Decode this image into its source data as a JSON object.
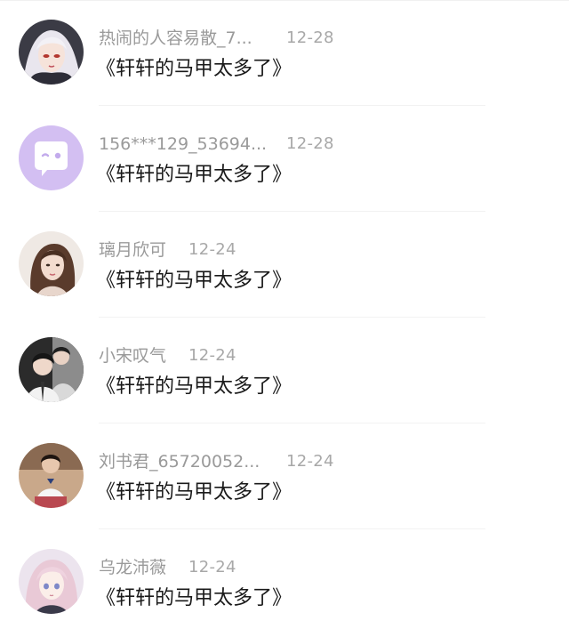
{
  "comments": [
    {
      "username": "热闹的人容易散_7...",
      "date": "12-28",
      "text": "《轩轩的马甲太多了》",
      "avatar": "anime-girl-white-hair-avatar"
    },
    {
      "username": "156***129_53694...",
      "date": "12-28",
      "text": "《轩轩的马甲太多了》",
      "avatar": "default-chat-bubble-avatar"
    },
    {
      "username": "璃月欣可",
      "date": "12-24",
      "text": "《轩轩的马甲太多了》",
      "avatar": "girl-selfie-avatar"
    },
    {
      "username": "小宋叹气",
      "date": "12-24",
      "text": "《轩轩的马甲太多了》",
      "avatar": "two-boys-photo-avatar"
    },
    {
      "username": "刘书君_65720052...",
      "date": "12-24",
      "text": "《轩轩的马甲太多了》",
      "avatar": "girl-school-uniform-avatar"
    },
    {
      "username": "乌龙沛薇",
      "date": "12-24",
      "text": "《轩轩的马甲太多了》",
      "avatar": "anime-girl-pink-hair-avatar"
    }
  ],
  "colors": {
    "username": "#9a9a9a",
    "date": "#a8a8a8",
    "text": "#1a1a1a",
    "chat_avatar_bg": "#d3bff2"
  }
}
